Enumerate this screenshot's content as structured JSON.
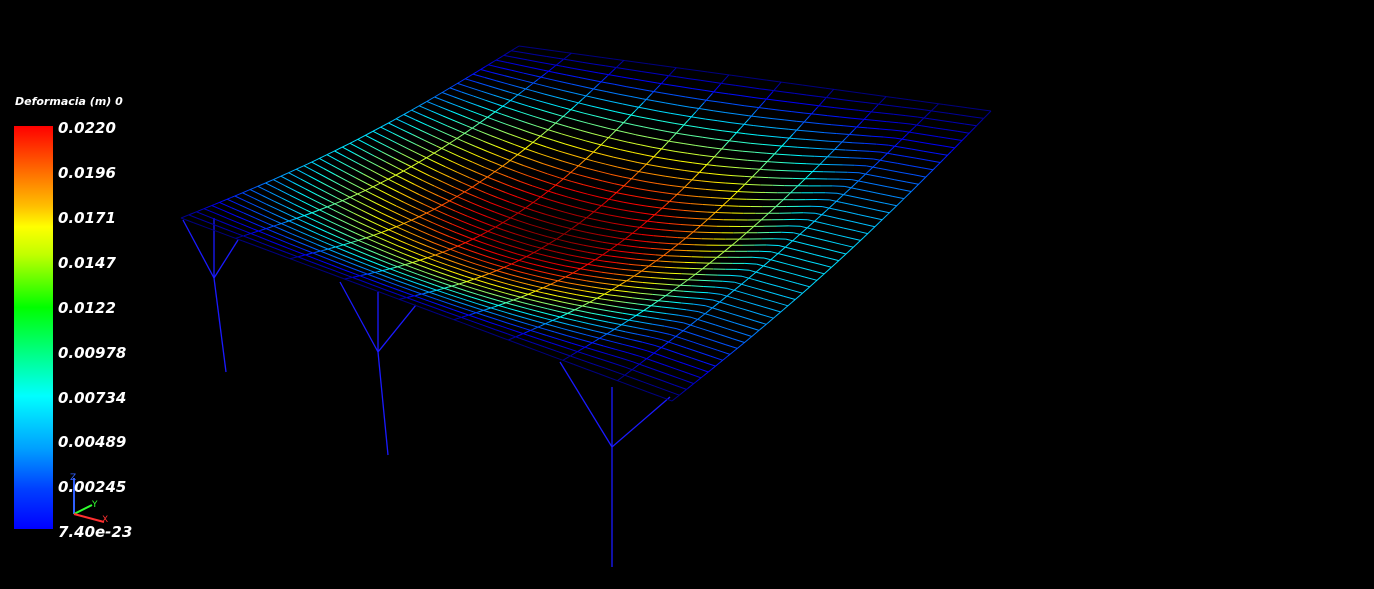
{
  "legend": {
    "title": "Deformacia (m) 0",
    "ticks": [
      "0.0220",
      "0.0196",
      "0.0171",
      "0.0147",
      "0.0122",
      "0.00978",
      "0.00734",
      "0.00489",
      "0.00245",
      "7.40e-23"
    ]
  },
  "axes_triad": {
    "x_label": "X",
    "y_label": "Y",
    "z_label": "Z",
    "x_color": "#ff3030",
    "y_color": "#30ff30",
    "z_color": "#3060ff"
  },
  "colors": {
    "background": "#000000",
    "frame": "#1a1aff",
    "max": "#ff0000",
    "min": "#0000ff"
  }
}
